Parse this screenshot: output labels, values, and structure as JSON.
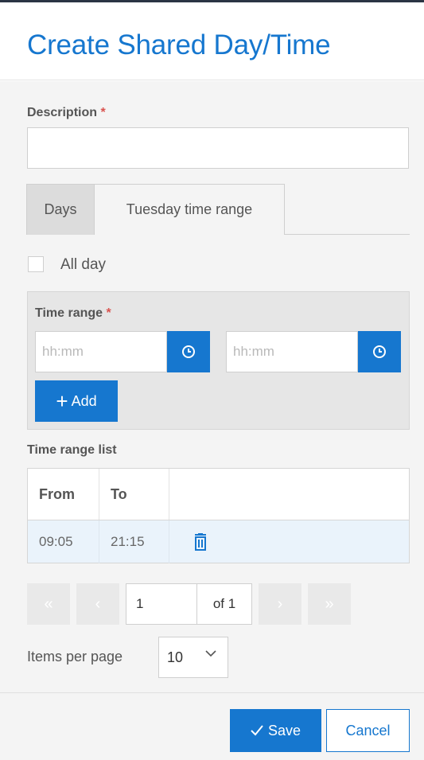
{
  "dialog": {
    "title": "Create Shared Day/Time"
  },
  "description": {
    "label": "Description",
    "required_mark": "*",
    "value": "",
    "placeholder": ""
  },
  "tabs": [
    {
      "label": "Days",
      "active": false
    },
    {
      "label": "Tuesday time range",
      "active": true
    }
  ],
  "all_day": {
    "label": "All day",
    "checked": false
  },
  "time_range": {
    "label": "Time range",
    "required_mark": "*",
    "from_placeholder": "hh:mm",
    "to_placeholder": "hh:mm",
    "add_label": "Add",
    "clock_icon": "clock-icon",
    "add_icon": "plus-icon"
  },
  "time_range_list": {
    "label": "Time range list",
    "columns": [
      "From",
      "To",
      ""
    ],
    "rows": [
      {
        "from": "09:05",
        "to": "21:15",
        "action_icon": "trash-icon"
      }
    ]
  },
  "pagination": {
    "current_page": "1",
    "of_label": "of 1"
  },
  "items_per_page": {
    "label": "Items per page",
    "value": "10"
  },
  "footer": {
    "save_label": "Save",
    "cancel_label": "Cancel",
    "save_icon": "checkmark-icon"
  },
  "colors": {
    "accent": "#1677cf",
    "panel": "#e6e6e6",
    "row_highlight": "#eaf3fb",
    "required": "#d9534f"
  }
}
